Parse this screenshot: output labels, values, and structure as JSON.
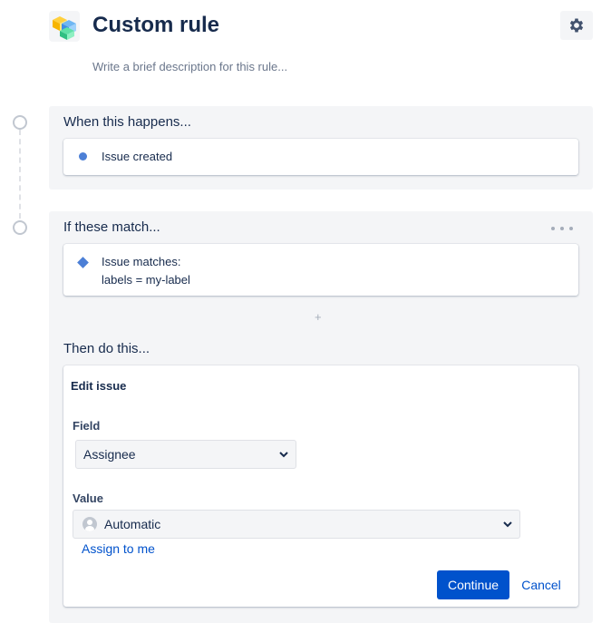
{
  "header": {
    "title": "Custom rule",
    "description_placeholder": "Write a brief description for this rule..."
  },
  "trigger": {
    "section_title": "When this happens...",
    "item_label": "Issue created"
  },
  "condition": {
    "section_title": "If these match...",
    "line1": "Issue matches:",
    "line2": "labels = my-label",
    "add_label": "+"
  },
  "action": {
    "section_title": "Then do this...",
    "form_title": "Edit issue",
    "field_label": "Field",
    "field_value": "Assignee",
    "value_label": "Value",
    "value_selected": "Automatic",
    "assign_link": "Assign to me",
    "continue_label": "Continue",
    "cancel_label": "Cancel"
  },
  "colors": {
    "primary": "#0052cc",
    "section_bg": "#f4f5f7",
    "accent_blue": "#4c7fd6",
    "text": "#172b4d"
  },
  "icons": [
    "automation-cube-icon",
    "gear-icon",
    "chevron-down-icon",
    "avatar-icon",
    "more-icon",
    "diamond-icon"
  ]
}
